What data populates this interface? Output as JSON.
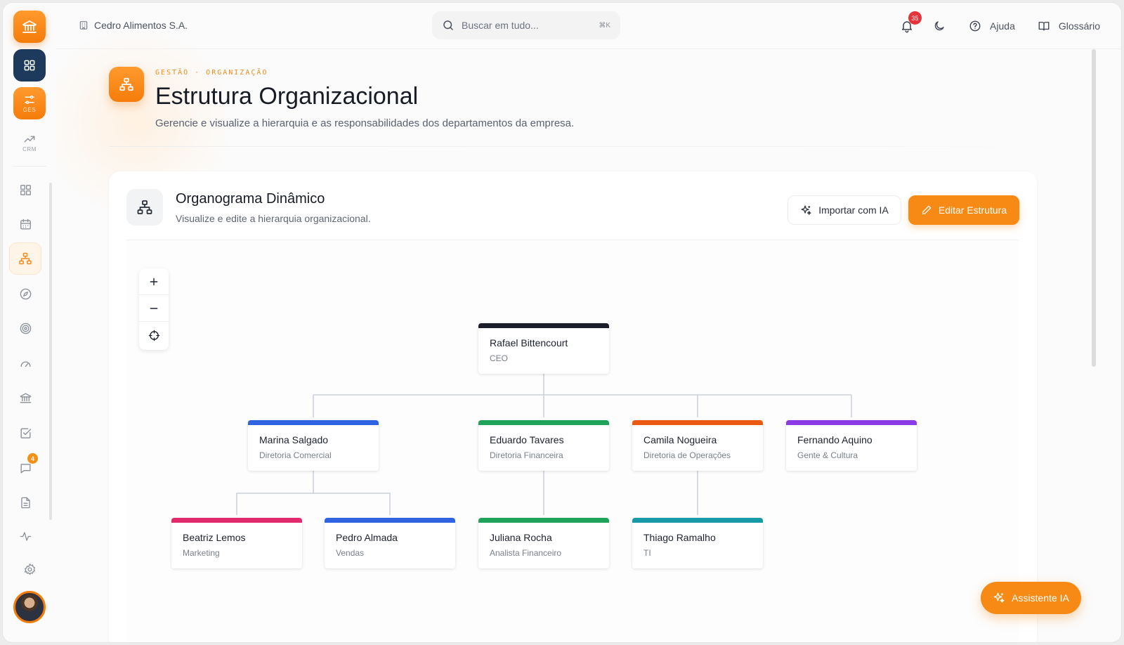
{
  "topbar": {
    "company": "Cedro Alimentos S.A.",
    "search_placeholder": "Buscar em tudo...",
    "search_shortcut": "⌘K",
    "notifications_count": "35",
    "help_label": "Ajuda",
    "glossary_label": "Glossário"
  },
  "sidebar": {
    "modules": [
      {
        "label": "",
        "icon": "grid-icon"
      },
      {
        "label": "GES",
        "icon": "sliders-icon"
      },
      {
        "label": "CRM",
        "icon": "trending-up-icon"
      }
    ],
    "nav": [
      {
        "icon": "dashboard-icon"
      },
      {
        "icon": "calendar-icon"
      },
      {
        "icon": "org-chart-icon",
        "active": true
      },
      {
        "icon": "compass-icon"
      },
      {
        "icon": "target-icon"
      },
      {
        "icon": "gauge-icon"
      },
      {
        "icon": "bank-icon"
      },
      {
        "icon": "checkbox-icon"
      },
      {
        "icon": "chat-icon",
        "badge": "4"
      },
      {
        "icon": "document-icon"
      },
      {
        "icon": "activity-icon"
      }
    ],
    "chat_badge": "4"
  },
  "header": {
    "breadcrumb": "GESTÃO · ORGANIZAÇÃO",
    "title": "Estrutura Organizacional",
    "subtitle": "Gerencie e visualize a hierarquia e as responsabilidades dos departamentos da empresa."
  },
  "card": {
    "title": "Organograma Dinâmico",
    "subtitle": "Visualize e edite a hierarquia organizacional.",
    "import_label": "Importar com IA",
    "edit_label": "Editar Estrutura"
  },
  "org": {
    "ceo": {
      "name": "Rafael Bittencourt",
      "role": "CEO",
      "color": "#1c1f2a"
    },
    "level1": [
      {
        "name": "Marina Salgado",
        "role": "Diretoria Comercial",
        "color": "#2f63e0"
      },
      {
        "name": "Eduardo Tavares",
        "role": "Diretoria Financeira",
        "color": "#1fa35a"
      },
      {
        "name": "Camila Nogueira",
        "role": "Diretoria de Operações",
        "color": "#ea5a12"
      },
      {
        "name": "Fernando Aquino",
        "role": "Gente & Cultura",
        "color": "#8a3be6"
      }
    ],
    "level2": [
      {
        "name": "Beatriz Lemos",
        "role": "Marketing",
        "color": "#e02a6c"
      },
      {
        "name": "Pedro Almada",
        "role": "Vendas",
        "color": "#2f63e0"
      },
      {
        "name": "Juliana Rocha",
        "role": "Analista Financeiro",
        "color": "#1fa35a"
      },
      {
        "name": "Thiago Ramalho",
        "role": "TI",
        "color": "#1799a8"
      }
    ]
  },
  "assistant_label": "Assistente IA",
  "colors": {
    "accent": "#f68a14",
    "dark_tile": "#1d3a5c"
  }
}
